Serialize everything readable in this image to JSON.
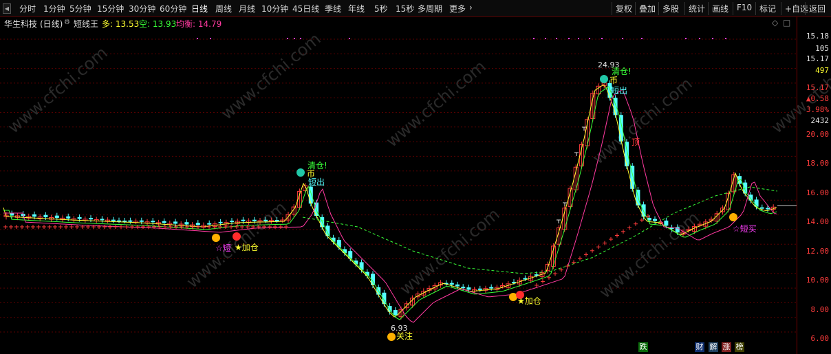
{
  "toolbar": {
    "periods": [
      "分时",
      "1分钟",
      "5分钟",
      "15分钟",
      "30分钟",
      "60分钟",
      "日线",
      "周线",
      "月线",
      "10分钟",
      "45日线",
      "季线",
      "年线",
      "5秒",
      "15秒",
      "多周期",
      "更多"
    ],
    "active_period": "日线",
    "right_buttons": [
      "复权",
      "叠加",
      "多股",
      "统计",
      "画线",
      "F10",
      "标记",
      "+自选",
      "返回"
    ]
  },
  "info": {
    "stock_name": "华生科技",
    "period_label": "(日线)",
    "indicator_name": "短线王",
    "duo_label": "多: 13.53",
    "kong_label": "空: 13.93",
    "junheng_label": "均衡: 14.79"
  },
  "right_panel": {
    "price_top": "15.18",
    "vol_top": "105",
    "price2": "15.17",
    "vol2": "497",
    "price3": "15.17",
    "change": "▲0.58",
    "change_pct": "3.98%",
    "volume": "2432"
  },
  "y_axis": {
    "ticks": [
      "20.00",
      "18.00",
      "16.00",
      "14.00",
      "12.00",
      "10.00",
      "8.00",
      "6.00"
    ]
  },
  "annotations": {
    "top_high": "24.93",
    "low_price": "6.93",
    "qingcang1": "清仓!",
    "bi1": "币",
    "duanchu1": "短出",
    "qingcang2": "清仓!",
    "bi2": "币",
    "duanchu2": "短出",
    "duanmai1": "☆短",
    "jiacang1": "★加仓",
    "jiacang2": "★加仓",
    "duanmai2": "☆短买",
    "ding": "顶",
    "dijia": "关注"
  },
  "bottom_badges": [
    "跌",
    "财",
    "解",
    "涨",
    "榜"
  ],
  "watermark": "www.cfchi.com",
  "colors": {
    "up": "#ff3c3c",
    "down": "#54ffff",
    "yellow": "#ffff30",
    "green": "#38ff38",
    "magenta": "#ff40ff",
    "pink": "#ff3aa0"
  }
}
